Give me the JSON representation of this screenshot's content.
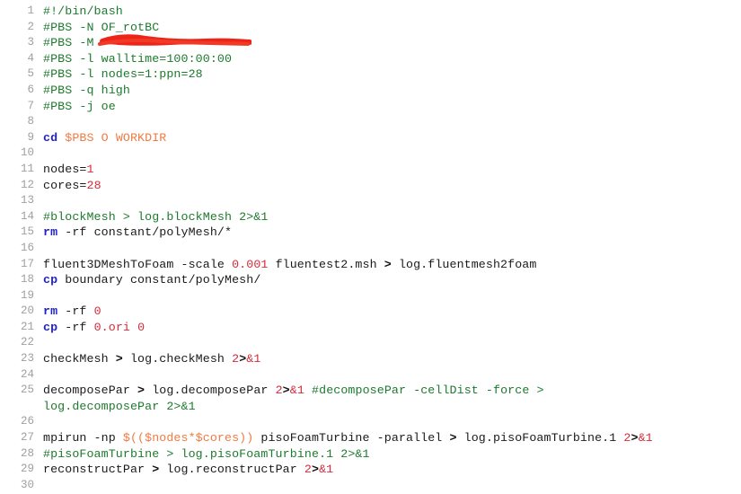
{
  "editor": {
    "title": "PBS batch script",
    "background_color": "#ffffff",
    "gutter_color": "#a0a0a0",
    "colors": {
      "comment": "#1d7a2e",
      "builtin": "#2222cc",
      "variable": "#f07a43",
      "number": "#d42b3a",
      "plain": "#1a1a1a",
      "redaction": "#ee2418"
    },
    "total_lines": 30,
    "redaction": {
      "present": true,
      "line": 3,
      "note": "red scribble covering email address"
    }
  },
  "lines": [
    {
      "n": "1",
      "tokens": [
        {
          "t": "comment",
          "s": "#!/bin/bash"
        }
      ]
    },
    {
      "n": "2",
      "tokens": [
        {
          "t": "comment",
          "s": "#PBS -N OF_rotBC"
        }
      ]
    },
    {
      "n": "3",
      "tokens": [
        {
          "t": "comment",
          "s": "#PBS -M "
        }
      ]
    },
    {
      "n": "4",
      "tokens": [
        {
          "t": "comment",
          "s": "#PBS -l walltime=100:00:00"
        }
      ]
    },
    {
      "n": "5",
      "tokens": [
        {
          "t": "comment",
          "s": "#PBS -l nodes=1:ppn=28"
        }
      ]
    },
    {
      "n": "6",
      "tokens": [
        {
          "t": "comment",
          "s": "#PBS -q high"
        }
      ]
    },
    {
      "n": "7",
      "tokens": [
        {
          "t": "comment",
          "s": "#PBS -j oe"
        }
      ]
    },
    {
      "n": "8",
      "tokens": []
    },
    {
      "n": "9",
      "tokens": [
        {
          "t": "builtin",
          "s": "cd"
        },
        {
          "t": "plain",
          "s": " "
        },
        {
          "t": "var",
          "s": "$PBS O WORKDIR"
        }
      ]
    },
    {
      "n": "10",
      "tokens": []
    },
    {
      "n": "11",
      "tokens": [
        {
          "t": "plain",
          "s": "nodes="
        },
        {
          "t": "num",
          "s": "1"
        }
      ]
    },
    {
      "n": "12",
      "tokens": [
        {
          "t": "plain",
          "s": "cores="
        },
        {
          "t": "num",
          "s": "28"
        }
      ]
    },
    {
      "n": "13",
      "tokens": []
    },
    {
      "n": "14",
      "tokens": [
        {
          "t": "comment",
          "s": "#blockMesh > log.blockMesh 2>&1"
        }
      ]
    },
    {
      "n": "15",
      "tokens": [
        {
          "t": "builtin",
          "s": "rm"
        },
        {
          "t": "plain",
          "s": " -rf constant/polyMesh/*"
        }
      ]
    },
    {
      "n": "16",
      "tokens": []
    },
    {
      "n": "17",
      "tokens": [
        {
          "t": "plain",
          "s": "fluent3DMeshToFoam -scale "
        },
        {
          "t": "num",
          "s": "0.001"
        },
        {
          "t": "plain",
          "s": " fluentest2.msh "
        },
        {
          "t": "redir",
          "s": ">"
        },
        {
          "t": "plain",
          "s": " log.fluentmesh2foam"
        }
      ]
    },
    {
      "n": "18",
      "tokens": [
        {
          "t": "builtin",
          "s": "cp"
        },
        {
          "t": "plain",
          "s": " boundary constant/polyMesh/"
        }
      ]
    },
    {
      "n": "19",
      "tokens": []
    },
    {
      "n": "20",
      "tokens": [
        {
          "t": "builtin",
          "s": "rm"
        },
        {
          "t": "plain",
          "s": " -rf "
        },
        {
          "t": "num",
          "s": "0"
        }
      ]
    },
    {
      "n": "21",
      "tokens": [
        {
          "t": "builtin",
          "s": "cp"
        },
        {
          "t": "plain",
          "s": " -rf "
        },
        {
          "t": "num",
          "s": "0.ori"
        },
        {
          "t": "plain",
          "s": " "
        },
        {
          "t": "num",
          "s": "0"
        }
      ]
    },
    {
      "n": "22",
      "tokens": []
    },
    {
      "n": "23",
      "tokens": [
        {
          "t": "plain",
          "s": "checkMesh "
        },
        {
          "t": "redir",
          "s": ">"
        },
        {
          "t": "plain",
          "s": " log.checkMesh "
        },
        {
          "t": "num",
          "s": "2"
        },
        {
          "t": "redir",
          "s": ">"
        },
        {
          "t": "num",
          "s": "&1"
        }
      ]
    },
    {
      "n": "24",
      "tokens": []
    },
    {
      "n": "25",
      "tokens": [
        {
          "t": "plain",
          "s": "decomposePar "
        },
        {
          "t": "redir",
          "s": ">"
        },
        {
          "t": "plain",
          "s": " log.decomposePar "
        },
        {
          "t": "num",
          "s": "2"
        },
        {
          "t": "redir",
          "s": ">"
        },
        {
          "t": "num",
          "s": "&1"
        },
        {
          "t": "plain",
          "s": " "
        },
        {
          "t": "comment",
          "s": "#decomposePar -cellDist -force >"
        }
      ]
    },
    {
      "n": "",
      "tokens": [
        {
          "t": "comment",
          "s": "log.decomposePar 2>&1"
        }
      ]
    },
    {
      "n": "26",
      "tokens": []
    },
    {
      "n": "27",
      "tokens": [
        {
          "t": "plain",
          "s": "mpirun -np "
        },
        {
          "t": "var",
          "s": "$(($nodes*$cores))"
        },
        {
          "t": "plain",
          "s": " pisoFoamTurbine -parallel "
        },
        {
          "t": "redir",
          "s": ">"
        },
        {
          "t": "plain",
          "s": " log.pisoFoamTurbine.1 "
        },
        {
          "t": "num",
          "s": "2"
        },
        {
          "t": "redir",
          "s": ">"
        },
        {
          "t": "num",
          "s": "&1"
        }
      ]
    },
    {
      "n": "28",
      "tokens": [
        {
          "t": "comment",
          "s": "#pisoFoamTurbine > log.pisoFoamTurbine.1 2>&1"
        }
      ]
    },
    {
      "n": "29",
      "tokens": [
        {
          "t": "plain",
          "s": "reconstructPar "
        },
        {
          "t": "redir",
          "s": ">"
        },
        {
          "t": "plain",
          "s": " log.reconstructPar "
        },
        {
          "t": "num",
          "s": "2"
        },
        {
          "t": "redir",
          "s": ">"
        },
        {
          "t": "num",
          "s": "&1"
        }
      ]
    },
    {
      "n": "30",
      "tokens": []
    }
  ]
}
